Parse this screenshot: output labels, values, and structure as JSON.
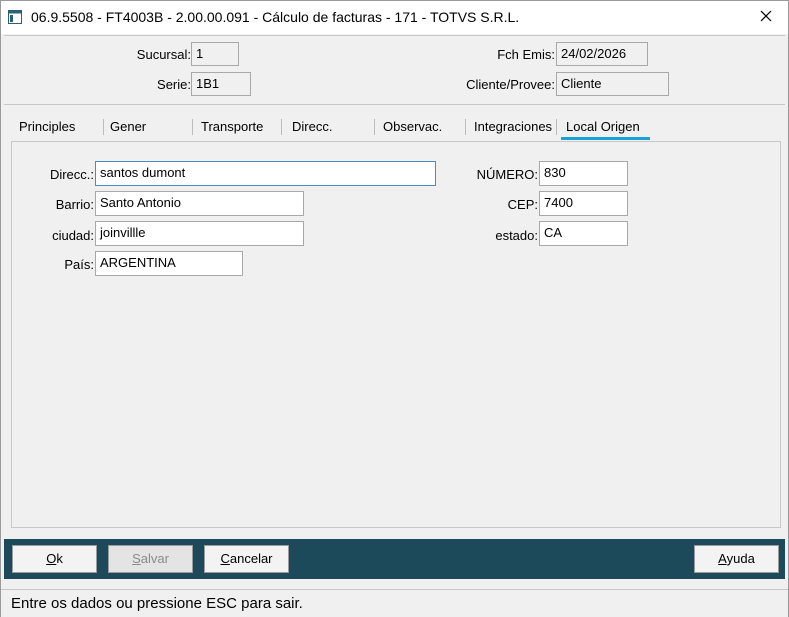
{
  "window": {
    "title": "06.9.5508 - FT4003B - 2.00.00.091 - Cálculo de facturas - 171 - TOTVS S.R.L.",
    "close_glyph": "✕"
  },
  "header": {
    "sucursal_label": "Sucursal:",
    "sucursal_value": "1",
    "serie_label": "Serie:",
    "serie_value": "1B1",
    "fch_emis_label": "Fch Emis:",
    "fch_emis_value": "24/02/2026",
    "cliente_label": "Cliente/Provee:",
    "cliente_value": "Cliente"
  },
  "tabs": [
    {
      "label": "Principles"
    },
    {
      "label": "Gener"
    },
    {
      "label": "Transporte"
    },
    {
      "label": "Direcc."
    },
    {
      "label": "Observac."
    },
    {
      "label": "Integraciones"
    },
    {
      "label": "Local Origen",
      "active": true
    }
  ],
  "form": {
    "direcc_label": "Direcc.:",
    "direcc_value": "santos dumont",
    "barrio_label": "Barrio:",
    "barrio_value": "Santo Antonio",
    "ciudad_label": "ciudad:",
    "ciudad_value": "joinvillle",
    "pais_label": "País:",
    "pais_value": "ARGENTINA",
    "numero_label": "NÚMERO:",
    "numero_value": "830",
    "cep_label": "CEP:",
    "cep_value": "7400",
    "estado_label": "estado:",
    "estado_value": "CA"
  },
  "buttons": {
    "ok": {
      "accel": "O",
      "rest": "k"
    },
    "salvar": {
      "accel": "S",
      "rest": "alvar"
    },
    "cancelar": {
      "accel": "C",
      "rest": "ancelar"
    },
    "ayuda": {
      "accel": "A",
      "rest": "yuda"
    }
  },
  "status": {
    "text": "Entre os dados ou pressione ESC para sair."
  },
  "colors": {
    "button_bar": "#1c4a5a",
    "active_tab_underline": "#1aa1d8",
    "focus_border": "#4a8ac9"
  },
  "icons": {
    "app": "app-window-icon",
    "close": "close-icon"
  }
}
